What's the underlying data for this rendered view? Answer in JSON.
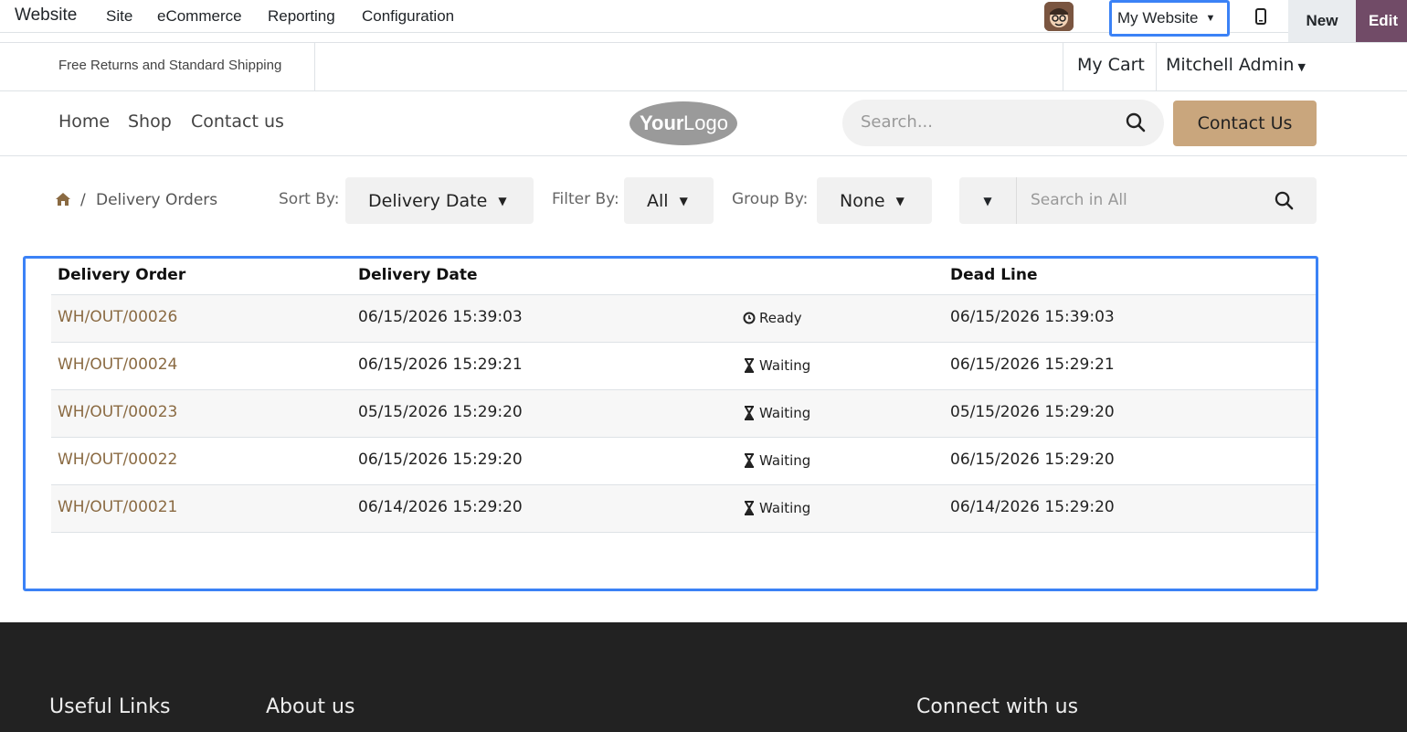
{
  "topbar": {
    "app_title": "Website",
    "menu": [
      "Site",
      "eCommerce",
      "Reporting",
      "Configuration"
    ],
    "website_switcher": "My Website",
    "new_label": "New",
    "edit_label": "Edit"
  },
  "subheader": {
    "promo": "Free Returns and Standard Shipping",
    "cart": "My Cart",
    "user": "Mitchell Admin"
  },
  "nav": {
    "links": [
      "Home",
      "Shop",
      "Contact us"
    ],
    "logo_text": "YourLogo",
    "search_placeholder": "Search...",
    "contact_button": "Contact Us"
  },
  "toolbar": {
    "breadcrumb_sep": "/",
    "breadcrumb_current": "Delivery Orders",
    "sort_label": "Sort By:",
    "sort_value": "Delivery Date",
    "filter_label": "Filter By:",
    "filter_value": "All",
    "group_label": "Group By:",
    "group_value": "None",
    "search_placeholder": "Search in All"
  },
  "table": {
    "headers": [
      "Delivery Order",
      "Delivery Date",
      "",
      "Dead Line"
    ],
    "rows": [
      {
        "order": "WH/OUT/00026",
        "date": "06/15/2026 15:39:03",
        "state": "Ready",
        "state_icon": "clock-icon",
        "deadline": "06/15/2026 15:39:03"
      },
      {
        "order": "WH/OUT/00024",
        "date": "06/15/2026 15:29:21",
        "state": "Waiting",
        "state_icon": "hourglass-icon",
        "deadline": "06/15/2026 15:29:21"
      },
      {
        "order": "WH/OUT/00023",
        "date": "05/15/2026 15:29:20",
        "state": "Waiting",
        "state_icon": "hourglass-icon",
        "deadline": "05/15/2026 15:29:20"
      },
      {
        "order": "WH/OUT/00022",
        "date": "06/15/2026 15:29:20",
        "state": "Waiting",
        "state_icon": "hourglass-icon",
        "deadline": "06/15/2026 15:29:20"
      },
      {
        "order": "WH/OUT/00021",
        "date": "06/14/2026 15:29:20",
        "state": "Waiting",
        "state_icon": "hourglass-icon",
        "deadline": "06/14/2026 15:29:20"
      }
    ]
  },
  "footer": {
    "headings": [
      "Useful Links",
      "About us",
      "Connect with us"
    ]
  },
  "colors": {
    "accent": "#3b82f6",
    "link": "#8a6a42",
    "edit_bg": "#714b67",
    "contact_bg": "#c9a67d",
    "footer_bg": "#222222"
  }
}
